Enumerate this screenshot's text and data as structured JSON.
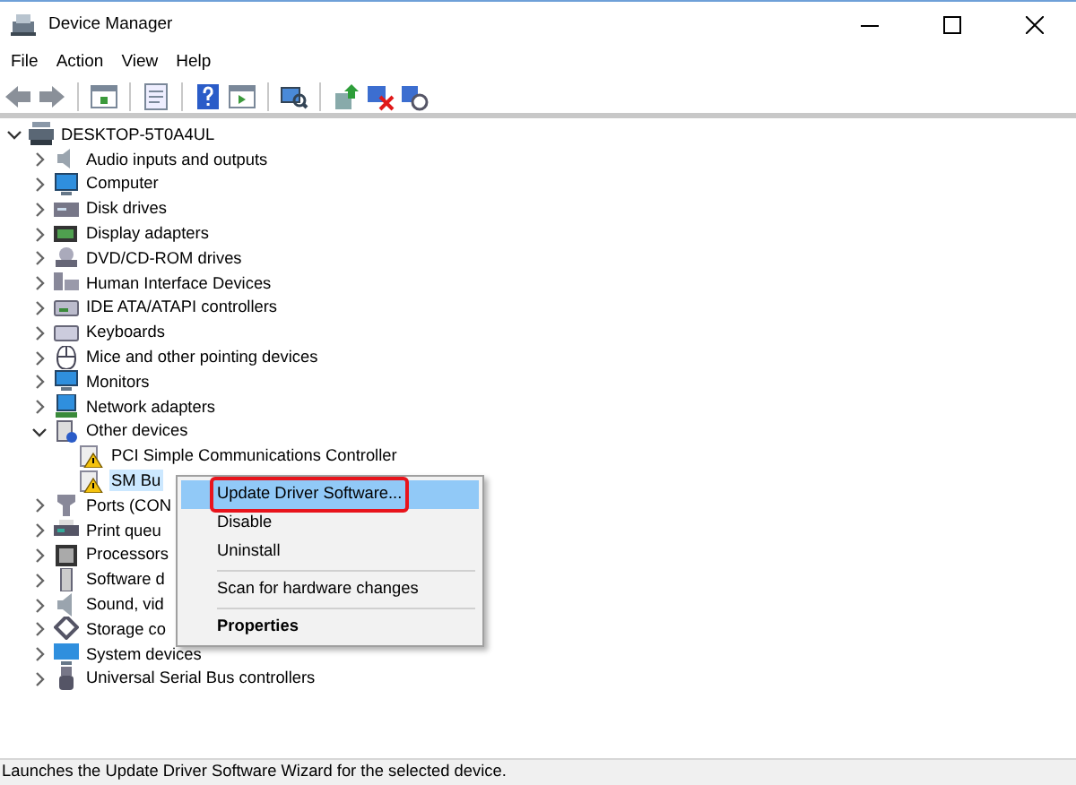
{
  "window": {
    "title": "Device Manager"
  },
  "menu_bar": [
    "File",
    "Action",
    "View",
    "Help"
  ],
  "tree": {
    "label": "DESKTOP-5T0A4UL",
    "expanded": true,
    "children": [
      {
        "label": "Audio inputs and outputs",
        "expanded": false
      },
      {
        "label": "Computer",
        "expanded": false
      },
      {
        "label": "Disk drives",
        "expanded": false
      },
      {
        "label": "Display adapters",
        "expanded": false
      },
      {
        "label": "DVD/CD-ROM drives",
        "expanded": false
      },
      {
        "label": "Human Interface Devices",
        "expanded": false
      },
      {
        "label": "IDE ATA/ATAPI controllers",
        "expanded": false
      },
      {
        "label": "Keyboards",
        "expanded": false
      },
      {
        "label": "Mice and other pointing devices",
        "expanded": false
      },
      {
        "label": "Monitors",
        "expanded": false
      },
      {
        "label": "Network adapters",
        "expanded": false
      },
      {
        "label": "Other devices",
        "expanded": true,
        "children": [
          {
            "label": "PCI Simple Communications Controller",
            "selected": false
          },
          {
            "label": "SM Bu",
            "selected": true
          }
        ]
      },
      {
        "label": "Ports (CON",
        "expanded": false
      },
      {
        "label": "Print queu",
        "expanded": false
      },
      {
        "label": "Processors",
        "expanded": false
      },
      {
        "label": "Software d",
        "expanded": false
      },
      {
        "label": "Sound, vid",
        "expanded": false
      },
      {
        "label": "Storage co",
        "expanded": false
      },
      {
        "label": "System devices",
        "expanded": false
      },
      {
        "label": "Universal Serial Bus controllers",
        "expanded": false
      }
    ]
  },
  "context_menu": [
    {
      "kind": "item",
      "label": "Update Driver Software...",
      "selected": true,
      "circled": true
    },
    {
      "kind": "item",
      "label": "Disable",
      "selected": false,
      "circled": false
    },
    {
      "kind": "item",
      "label": "Uninstall",
      "selected": false,
      "circled": false
    },
    {
      "kind": "separator"
    },
    {
      "kind": "item",
      "label": "Scan for hardware changes",
      "selected": false,
      "circled": false
    },
    {
      "kind": "separator"
    },
    {
      "kind": "default",
      "label": "Properties",
      "selected": false,
      "circled": false
    }
  ],
  "status_bar": "Launches the Update Driver Software Wizard for the selected device."
}
